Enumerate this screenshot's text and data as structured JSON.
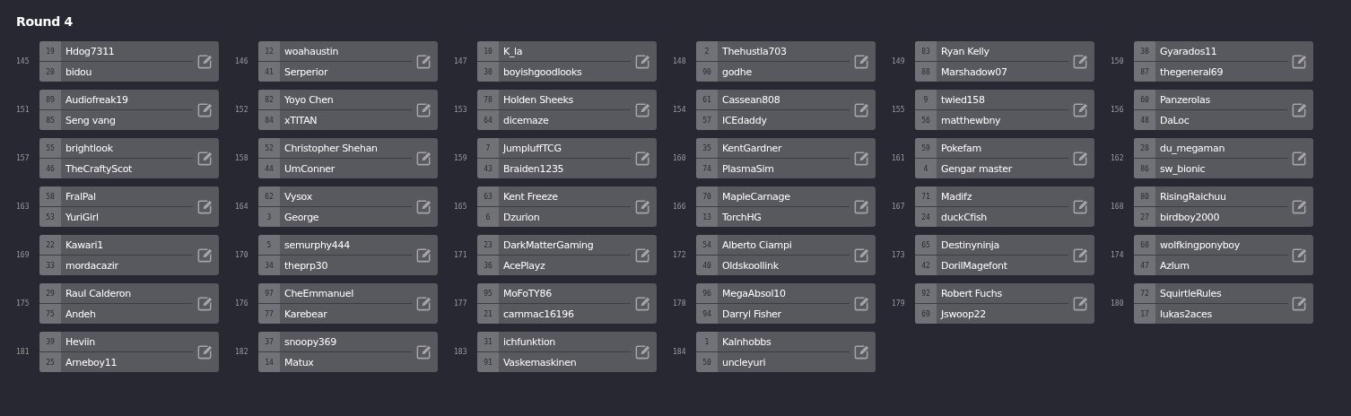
{
  "title": "Round 4",
  "matches": [
    {
      "number": "145",
      "players": [
        {
          "seed": "19",
          "name": "Hdog7311"
        },
        {
          "seed": "20",
          "name": "bidou"
        }
      ]
    },
    {
      "number": "146",
      "players": [
        {
          "seed": "12",
          "name": "woahaustin"
        },
        {
          "seed": "41",
          "name": "Serperior"
        }
      ]
    },
    {
      "number": "147",
      "players": [
        {
          "seed": "10",
          "name": "K_la"
        },
        {
          "seed": "30",
          "name": "boyishgoodlooks"
        }
      ]
    },
    {
      "number": "148",
      "players": [
        {
          "seed": "2",
          "name": "Thehustla703"
        },
        {
          "seed": "90",
          "name": "godhe"
        }
      ]
    },
    {
      "number": "149",
      "players": [
        {
          "seed": "83",
          "name": "Ryan Kelly"
        },
        {
          "seed": "88",
          "name": "Marshadow07"
        }
      ]
    },
    {
      "number": "150",
      "players": [
        {
          "seed": "38",
          "name": "Gyarados11"
        },
        {
          "seed": "87",
          "name": "thegeneral69"
        }
      ]
    },
    {
      "number": "151",
      "players": [
        {
          "seed": "89",
          "name": "Audiofreak19"
        },
        {
          "seed": "85",
          "name": "Seng vang"
        }
      ]
    },
    {
      "number": "152",
      "players": [
        {
          "seed": "82",
          "name": "Yoyo Chen"
        },
        {
          "seed": "84",
          "name": "xTITAN"
        }
      ]
    },
    {
      "number": "153",
      "players": [
        {
          "seed": "78",
          "name": "Holden Sheeks"
        },
        {
          "seed": "64",
          "name": "dicemaze"
        }
      ]
    },
    {
      "number": "154",
      "players": [
        {
          "seed": "61",
          "name": "Cassean808"
        },
        {
          "seed": "57",
          "name": "ICEdaddy"
        }
      ]
    },
    {
      "number": "155",
      "players": [
        {
          "seed": "9",
          "name": "twied158"
        },
        {
          "seed": "56",
          "name": "matthewbny"
        }
      ]
    },
    {
      "number": "156",
      "players": [
        {
          "seed": "60",
          "name": "Panzerolas"
        },
        {
          "seed": "48",
          "name": "DaLoc"
        }
      ]
    },
    {
      "number": "157",
      "players": [
        {
          "seed": "55",
          "name": "brightlook"
        },
        {
          "seed": "46",
          "name": "TheCraftyScot"
        }
      ]
    },
    {
      "number": "158",
      "players": [
        {
          "seed": "52",
          "name": "Christopher Shehan"
        },
        {
          "seed": "44",
          "name": "UmConner"
        }
      ]
    },
    {
      "number": "159",
      "players": [
        {
          "seed": "7",
          "name": "JumpluffTCG"
        },
        {
          "seed": "43",
          "name": "Braiden1235"
        }
      ]
    },
    {
      "number": "160",
      "players": [
        {
          "seed": "35",
          "name": "KentGardner"
        },
        {
          "seed": "74",
          "name": "PlasmaSim"
        }
      ]
    },
    {
      "number": "161",
      "players": [
        {
          "seed": "59",
          "name": "Pokefam"
        },
        {
          "seed": "4",
          "name": "Gengar master"
        }
      ]
    },
    {
      "number": "162",
      "players": [
        {
          "seed": "28",
          "name": "du_megaman"
        },
        {
          "seed": "86",
          "name": "sw_bionic"
        }
      ]
    },
    {
      "number": "163",
      "players": [
        {
          "seed": "58",
          "name": "FralPal"
        },
        {
          "seed": "53",
          "name": "YuriGirl"
        }
      ]
    },
    {
      "number": "164",
      "players": [
        {
          "seed": "62",
          "name": "Vysox"
        },
        {
          "seed": "3",
          "name": "George"
        }
      ]
    },
    {
      "number": "165",
      "players": [
        {
          "seed": "63",
          "name": "Kent Freeze"
        },
        {
          "seed": "6",
          "name": "Dzurion"
        }
      ]
    },
    {
      "number": "166",
      "players": [
        {
          "seed": "70",
          "name": "MapleCarnage"
        },
        {
          "seed": "13",
          "name": "TorchHG"
        }
      ]
    },
    {
      "number": "167",
      "players": [
        {
          "seed": "71",
          "name": "Madifz"
        },
        {
          "seed": "24",
          "name": "duckCfish"
        }
      ]
    },
    {
      "number": "168",
      "players": [
        {
          "seed": "80",
          "name": "RisingRaichuu"
        },
        {
          "seed": "27",
          "name": "birdboy2000"
        }
      ]
    },
    {
      "number": "169",
      "players": [
        {
          "seed": "22",
          "name": "Kawari1"
        },
        {
          "seed": "33",
          "name": "mordacazir"
        }
      ]
    },
    {
      "number": "170",
      "players": [
        {
          "seed": "5",
          "name": "semurphy444"
        },
        {
          "seed": "34",
          "name": "theprp30"
        }
      ]
    },
    {
      "number": "171",
      "players": [
        {
          "seed": "23",
          "name": "DarkMatterGaming"
        },
        {
          "seed": "36",
          "name": "AcePlayz"
        }
      ]
    },
    {
      "number": "172",
      "players": [
        {
          "seed": "54",
          "name": "Alberto Ciampi"
        },
        {
          "seed": "40",
          "name": "Oldskoollink"
        }
      ]
    },
    {
      "number": "173",
      "players": [
        {
          "seed": "65",
          "name": "Destinyninja"
        },
        {
          "seed": "42",
          "name": "DorilMagefont"
        }
      ]
    },
    {
      "number": "174",
      "players": [
        {
          "seed": "68",
          "name": "wolfkingponyboy"
        },
        {
          "seed": "47",
          "name": "Azlum"
        }
      ]
    },
    {
      "number": "175",
      "players": [
        {
          "seed": "29",
          "name": "Raul Calderon"
        },
        {
          "seed": "75",
          "name": "Andeh"
        }
      ]
    },
    {
      "number": "176",
      "players": [
        {
          "seed": "97",
          "name": "CheEmmanuel"
        },
        {
          "seed": "77",
          "name": "Karebear"
        }
      ]
    },
    {
      "number": "177",
      "players": [
        {
          "seed": "95",
          "name": "MoFoTY86"
        },
        {
          "seed": "21",
          "name": "cammac16196"
        }
      ]
    },
    {
      "number": "178",
      "players": [
        {
          "seed": "96",
          "name": "MegaAbsol10"
        },
        {
          "seed": "94",
          "name": "Darryl Fisher"
        }
      ]
    },
    {
      "number": "179",
      "players": [
        {
          "seed": "92",
          "name": "Robert Fuchs"
        },
        {
          "seed": "69",
          "name": "Jswoop22"
        }
      ]
    },
    {
      "number": "180",
      "players": [
        {
          "seed": "72",
          "name": "SquirtleRules"
        },
        {
          "seed": "17",
          "name": "lukas2aces"
        }
      ]
    },
    {
      "number": "181",
      "players": [
        {
          "seed": "39",
          "name": "Heviin"
        },
        {
          "seed": "25",
          "name": "Arneboy11"
        }
      ]
    },
    {
      "number": "182",
      "players": [
        {
          "seed": "37",
          "name": "snoopy369"
        },
        {
          "seed": "14",
          "name": "Matux"
        }
      ]
    },
    {
      "number": "183",
      "players": [
        {
          "seed": "31",
          "name": "ichfunktion"
        },
        {
          "seed": "91",
          "name": "Vaskemaskinen"
        }
      ]
    },
    {
      "number": "184",
      "players": [
        {
          "seed": "1",
          "name": "Kalnhobbs"
        },
        {
          "seed": "50",
          "name": "uncleyuri"
        }
      ]
    }
  ]
}
